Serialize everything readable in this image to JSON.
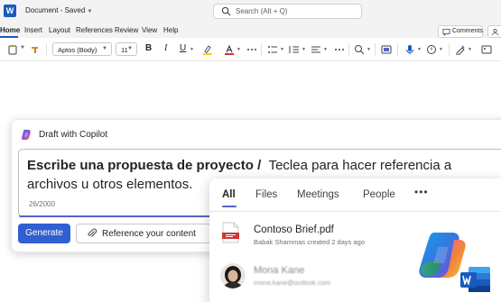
{
  "titlebar": {
    "app_badge": "W",
    "document": "Document",
    "status": "Saved",
    "search_placeholder": "Search (Alt + Q)"
  },
  "menu": {
    "items": [
      "Home",
      "Insert",
      "Layout",
      "References",
      "Review",
      "View",
      "Help"
    ],
    "active": "Home",
    "comments_label": "Comments"
  },
  "ribbon": {
    "font_name": "Aptos (Body)",
    "font_size": "11",
    "bold_glyph": "B",
    "italic_glyph": "I",
    "underline_glyph": "U",
    "icons": [
      "paste-icon",
      "format-painter-icon",
      "highlight-icon",
      "font-color-icon",
      "bullets-icon",
      "numbering-icon",
      "indent-icon",
      "align-icon",
      "styles-icon",
      "find-icon",
      "editor-icon",
      "dictate-icon",
      "sensitivity-icon",
      "designer-icon",
      "copilot-icon"
    ]
  },
  "copilot": {
    "title": "Draft with Copilot",
    "prompt_bold": "Escribe una propuesta de proyecto /",
    "prompt_rest": "Teclea para hacer referencia a archivos u otros elementos.",
    "counter": "26/2000",
    "generate_label": "Generate",
    "reference_label": "Reference your content"
  },
  "dropdown": {
    "tabs": [
      "All",
      "Files",
      "Meetings",
      "People"
    ],
    "active_tab": "All",
    "more_glyph": "•••",
    "file": {
      "name": "Contoso Brief.pdf",
      "meta": "Babak Shammas created 2 days ago"
    },
    "person": {
      "name": "Mona Kane",
      "email": "mona.kane@outlook.com"
    }
  },
  "colors": {
    "word_blue": "#185abd",
    "accent": "#5b5fc7",
    "generate_button": "#2f5fd1"
  }
}
